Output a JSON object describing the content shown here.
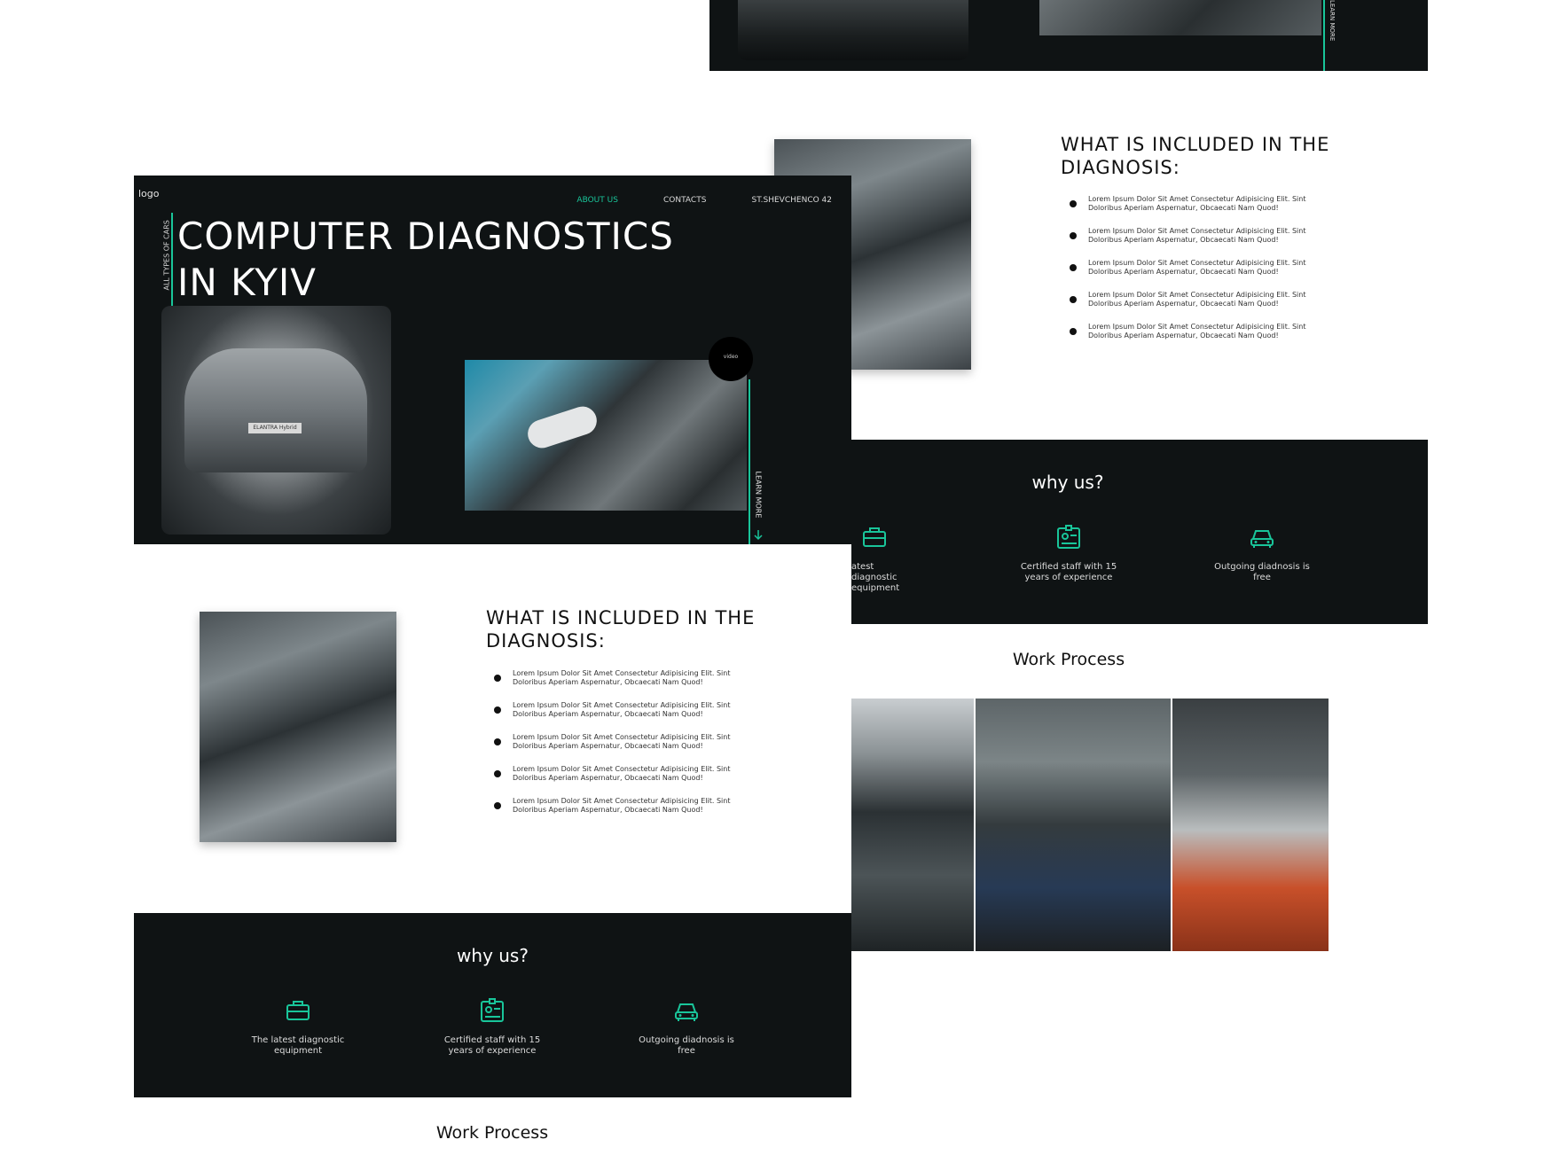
{
  "accent_color": "#19c59a",
  "dark_color": "#0f1314",
  "top_strip": {
    "side_label": "LEARN MORE"
  },
  "back_mockup": {
    "included_title": "WHAT IS INCLUDED IN THE DIAGNOSIS:",
    "bullets": [
      "Lorem Ipsum Dolor Sit Amet Consectetur Adipisicing Elit. Sint Doloribus Aperiam Aspernatur, Obcaecati Nam Quod!",
      "Lorem Ipsum Dolor Sit Amet Consectetur Adipisicing Elit. Sint Doloribus Aperiam Aspernatur, Obcaecati Nam Quod!",
      "Lorem Ipsum Dolor Sit Amet Consectetur Adipisicing Elit. Sint Doloribus Aperiam Aspernatur, Obcaecati Nam Quod!",
      "Lorem Ipsum Dolor Sit Amet Consectetur Adipisicing Elit. Sint Doloribus Aperiam Aspernatur, Obcaecati Nam Quod!",
      "Lorem Ipsum Dolor Sit Amet Consectetur Adipisicing Elit. Sint Doloribus Aperiam Aspernatur, Obcaecati Nam Quod!"
    ],
    "why_title": "why us?",
    "why_items": [
      {
        "label": "atest diagnostic equipment",
        "icon": "toolbox-icon"
      },
      {
        "label": "Certified staff with 15 years of experience",
        "icon": "id-card-icon"
      },
      {
        "label": "Outgoing diadnosis is free",
        "icon": "car-icon"
      }
    ],
    "work_process_title": "Work Process"
  },
  "front_mockup": {
    "logo": "logo",
    "nav": [
      "ABOUT US",
      "CONTACTS",
      "ST.SHEVCHENCO 42"
    ],
    "side_label": "ALL TYPES OF CARS",
    "hero_line1": "COMPUTER DIAGNOSTICS",
    "hero_line2": "IN KYIV",
    "video_label": "video",
    "learn_more": "LEARN MORE",
    "plate_text": "ELANTRA Hybrid",
    "included_title": "WHAT IS INCLUDED IN THE DIAGNOSIS:",
    "bullets": [
      "Lorem Ipsum Dolor Sit Amet Consectetur Adipisicing Elit. Sint Doloribus Aperiam Aspernatur, Obcaecati Nam Quod!",
      "Lorem Ipsum Dolor Sit Amet Consectetur Adipisicing Elit. Sint Doloribus Aperiam Aspernatur, Obcaecati Nam Quod!",
      "Lorem Ipsum Dolor Sit Amet Consectetur Adipisicing Elit. Sint Doloribus Aperiam Aspernatur, Obcaecati Nam Quod!",
      "Lorem Ipsum Dolor Sit Amet Consectetur Adipisicing Elit. Sint Doloribus Aperiam Aspernatur, Obcaecati Nam Quod!",
      "Lorem Ipsum Dolor Sit Amet Consectetur Adipisicing Elit. Sint Doloribus Aperiam Aspernatur, Obcaecati Nam Quod!"
    ],
    "why_title": "why us?",
    "why_items": [
      {
        "label": "The latest diagnostic equipment",
        "icon": "toolbox-icon"
      },
      {
        "label": "Certified staff with 15 years of experience",
        "icon": "id-card-icon"
      },
      {
        "label": "Outgoing diadnosis is free",
        "icon": "car-icon"
      }
    ],
    "work_process_title": "Work Process"
  }
}
